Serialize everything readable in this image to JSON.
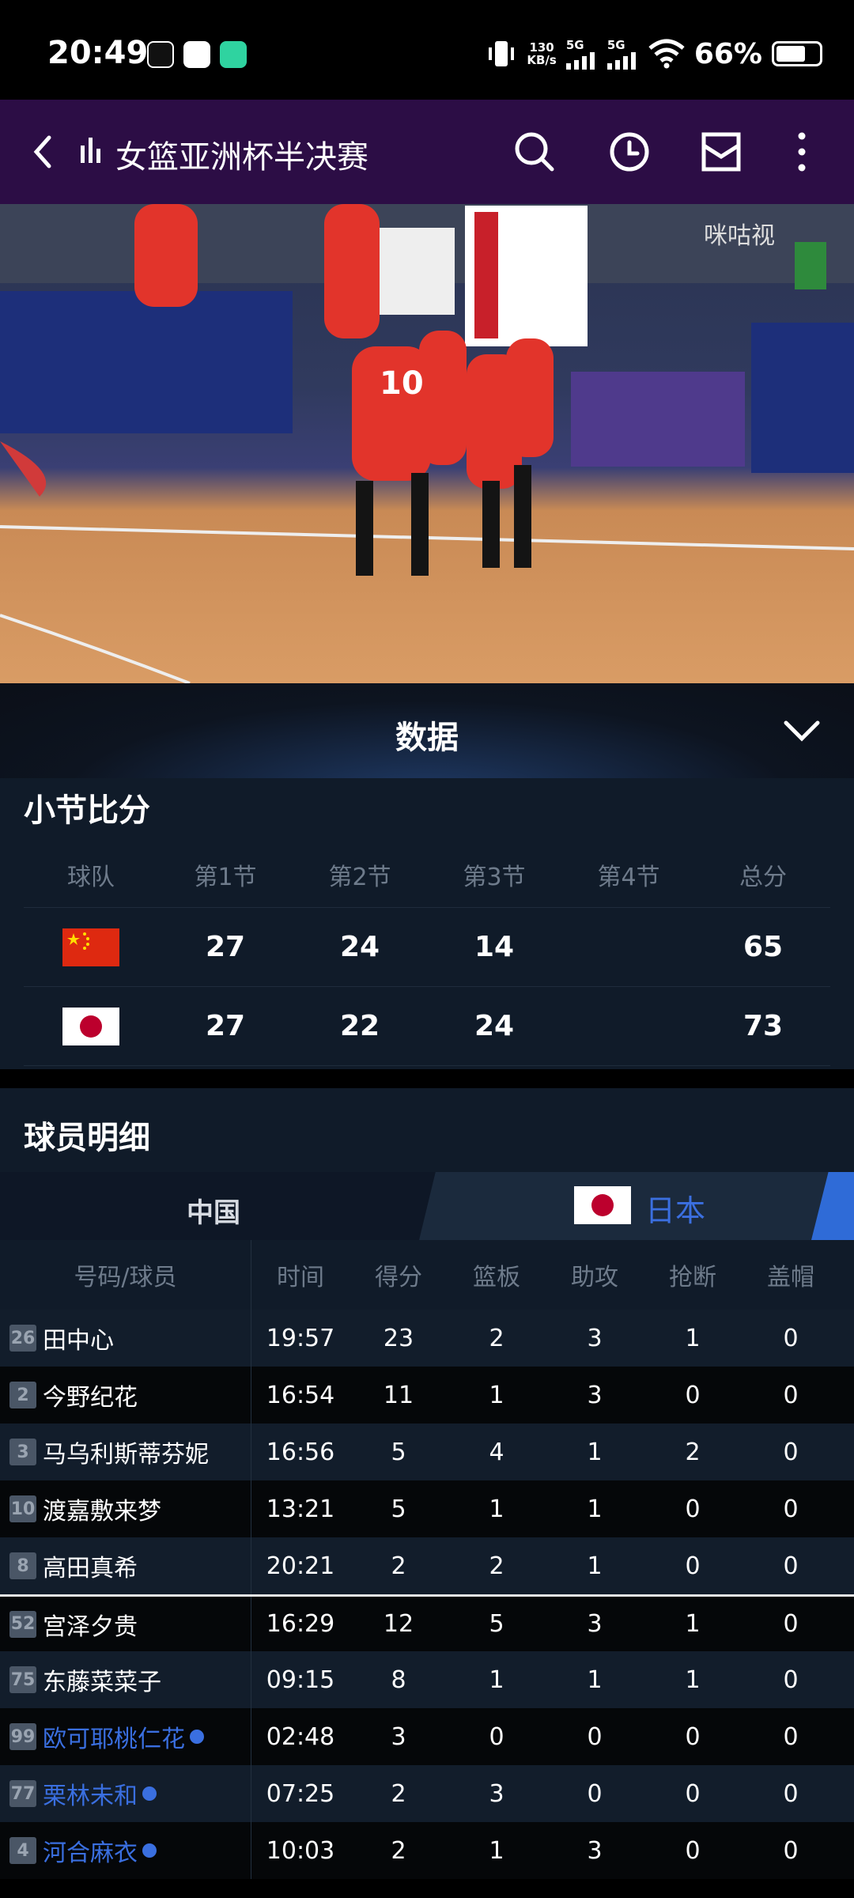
{
  "status_bar": {
    "time": "20:49",
    "net_speed_top": "130",
    "net_speed_bottom": "KB/s",
    "signal1": "5G",
    "signal2": "5G",
    "battery": "66%"
  },
  "header": {
    "title": "女篮亚洲杯半决赛"
  },
  "video": {
    "watermark": "咪咕视"
  },
  "data_panel": {
    "title": "数据"
  },
  "quarter_scores": {
    "title": "小节比分",
    "columns": [
      "球队",
      "第1节",
      "第2节",
      "第3节",
      "第4节",
      "总分"
    ],
    "rows": [
      {
        "team": "china-flag",
        "q1": "27",
        "q2": "24",
        "q3": "14",
        "q4": "",
        "total": "65"
      },
      {
        "team": "japan-flag",
        "q1": "27",
        "q2": "22",
        "q3": "24",
        "q4": "",
        "total": "73"
      }
    ]
  },
  "players": {
    "title": "球员明细",
    "tabs": {
      "china": "中国",
      "japan": "日本"
    },
    "columns": [
      "号码/球员",
      "时间",
      "得分",
      "篮板",
      "助攻",
      "抢断",
      "盖帽"
    ],
    "rows": [
      {
        "num": "26",
        "name": "田中心",
        "time": "19:57",
        "pts": "23",
        "reb": "2",
        "ast": "3",
        "stl": "1",
        "blk": "0",
        "sub": false
      },
      {
        "num": "2",
        "name": "今野纪花",
        "time": "16:54",
        "pts": "11",
        "reb": "1",
        "ast": "3",
        "stl": "0",
        "blk": "0",
        "sub": false
      },
      {
        "num": "3",
        "name": "马乌利斯蒂芬妮",
        "time": "16:56",
        "pts": "5",
        "reb": "4",
        "ast": "1",
        "stl": "2",
        "blk": "0",
        "sub": false
      },
      {
        "num": "10",
        "name": "渡嘉敷来梦",
        "time": "13:21",
        "pts": "5",
        "reb": "1",
        "ast": "1",
        "stl": "0",
        "blk": "0",
        "sub": false
      },
      {
        "num": "8",
        "name": "高田真希",
        "time": "20:21",
        "pts": "2",
        "reb": "2",
        "ast": "1",
        "stl": "0",
        "blk": "0",
        "sub": false
      },
      {
        "num": "52",
        "name": "宫泽夕贵",
        "time": "16:29",
        "pts": "12",
        "reb": "5",
        "ast": "3",
        "stl": "1",
        "blk": "0",
        "sub": false
      },
      {
        "num": "75",
        "name": "东藤菜菜子",
        "time": "09:15",
        "pts": "8",
        "reb": "1",
        "ast": "1",
        "stl": "1",
        "blk": "0",
        "sub": false
      },
      {
        "num": "99",
        "name": "欧可耶桃仁花",
        "time": "02:48",
        "pts": "3",
        "reb": "0",
        "ast": "0",
        "stl": "0",
        "blk": "0",
        "sub": true
      },
      {
        "num": "77",
        "name": "栗林未和",
        "time": "07:25",
        "pts": "2",
        "reb": "3",
        "ast": "0",
        "stl": "0",
        "blk": "0",
        "sub": true
      },
      {
        "num": "4",
        "name": "河合麻衣",
        "time": "10:03",
        "pts": "2",
        "reb": "1",
        "ast": "3",
        "stl": "0",
        "blk": "0",
        "sub": true
      }
    ]
  }
}
